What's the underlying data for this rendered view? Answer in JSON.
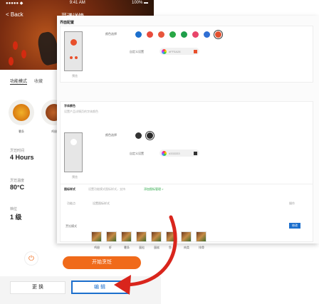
{
  "phone": {
    "status": {
      "carrier": "●●●●●  ◆",
      "time": "9:41 AM",
      "battery": "100% ▬"
    },
    "back": "< Back",
    "title": "菜谱详情",
    "tabs": [
      "功能模式",
      "收藏"
    ],
    "icon_captions": [
      "薯条",
      "鸡翅"
    ],
    "specs": [
      {
        "key": "烹饪时间",
        "value": "4 Hours"
      },
      {
        "key": "烹饪温度",
        "value": "80°C"
      },
      {
        "key": "档位",
        "value": "1 级"
      }
    ],
    "power_symbol": "⏻",
    "start_label": "开始烹饪",
    "switch_label": "更 换",
    "edit_label": "编 辑"
  },
  "panel": {
    "title": "界面配置",
    "theme": {
      "label": "颜色选择",
      "preview_caption": "预览",
      "colors": [
        "#1c6fcd",
        "#e84b3c",
        "#e8563c",
        "#28a745",
        "#1e9e4a",
        "#e8456a",
        "#2f6fd4",
        "#e4502e"
      ],
      "custom_label": "自定义设置",
      "custom_value": "#FF5A28",
      "custom_color": "#e8502c"
    },
    "font": {
      "title": "字体颜色",
      "desc": "设置产品详情页的字体颜色",
      "label": "颜色选择",
      "preview_caption": "预览",
      "colors": [
        "#333333",
        "#2a2a2a"
      ],
      "custom_label": "自定义设置",
      "custom_value": "#333333",
      "custom_color": "#333333"
    },
    "icons": {
      "title": "图标样式",
      "desc": "设置功能模式图标样式，支持",
      "link": "添加图标管理 >",
      "headers": [
        "功能点",
        "设置图标样式",
        "操作"
      ],
      "row_label": "烹饪模式",
      "captions": [
        "鸡翅",
        "虾",
        "薯条",
        "蛋挞",
        "蛋糕",
        "鱼",
        "肉类",
        "排骨"
      ],
      "edit": "修改"
    }
  },
  "colors": {
    "accent": "#f06a1a",
    "link_blue": "#1c6fcd",
    "arrow_red": "#d9251c"
  }
}
